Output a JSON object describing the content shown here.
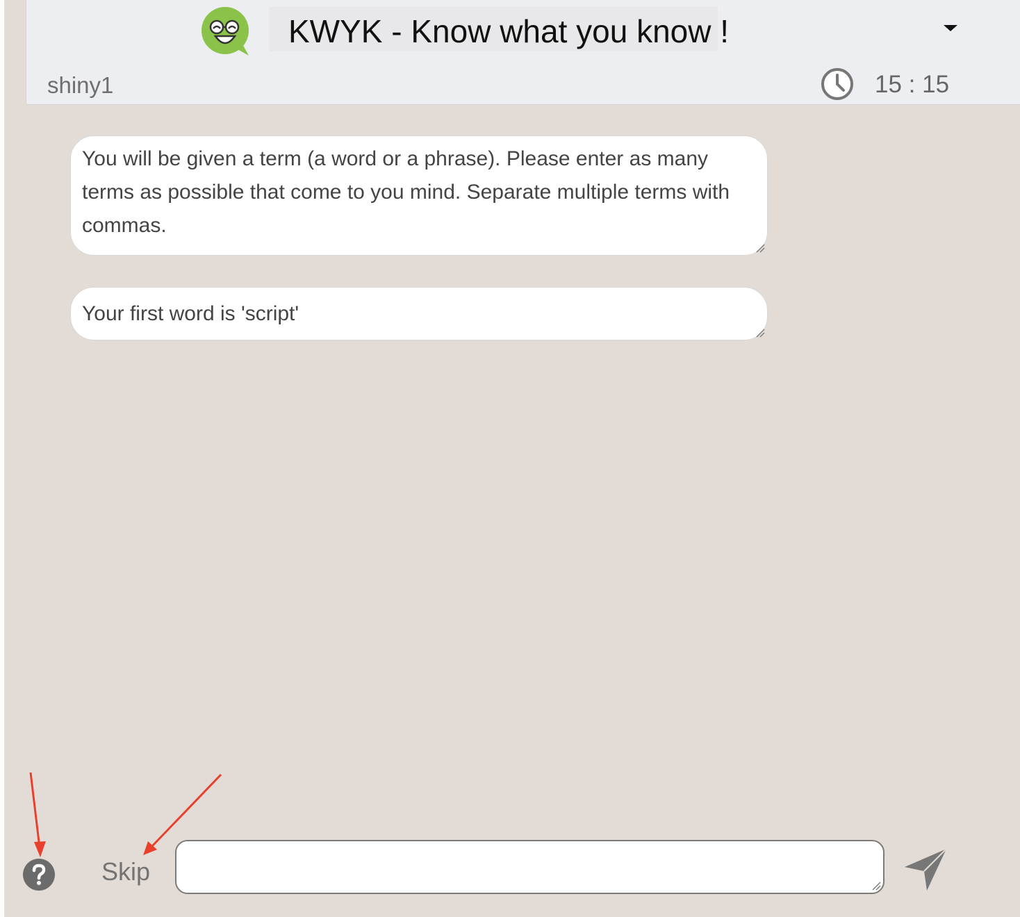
{
  "header": {
    "title": "KWYK - Know what you know !",
    "username": "shiny1",
    "timer": "15 : 15"
  },
  "messages": [
    {
      "text": "You will be given a term (a word or a phrase). Please enter as many terms as possible that come to you mind. Separate multiple terms with commas."
    },
    {
      "text": "Your first word is 'script'"
    }
  ],
  "footer": {
    "skip_label": "Skip",
    "input_value": ""
  },
  "colors": {
    "background": "#e3dcd6",
    "header": "#edeef1",
    "logo_green": "#8bc34a",
    "annotation_arrow": "#e8402c",
    "icon_gray": "#6b6b6b"
  },
  "icons": [
    "logo-icon",
    "dropdown-caret-icon",
    "clock-icon",
    "help-icon",
    "send-icon",
    "resize-grip-icon"
  ]
}
